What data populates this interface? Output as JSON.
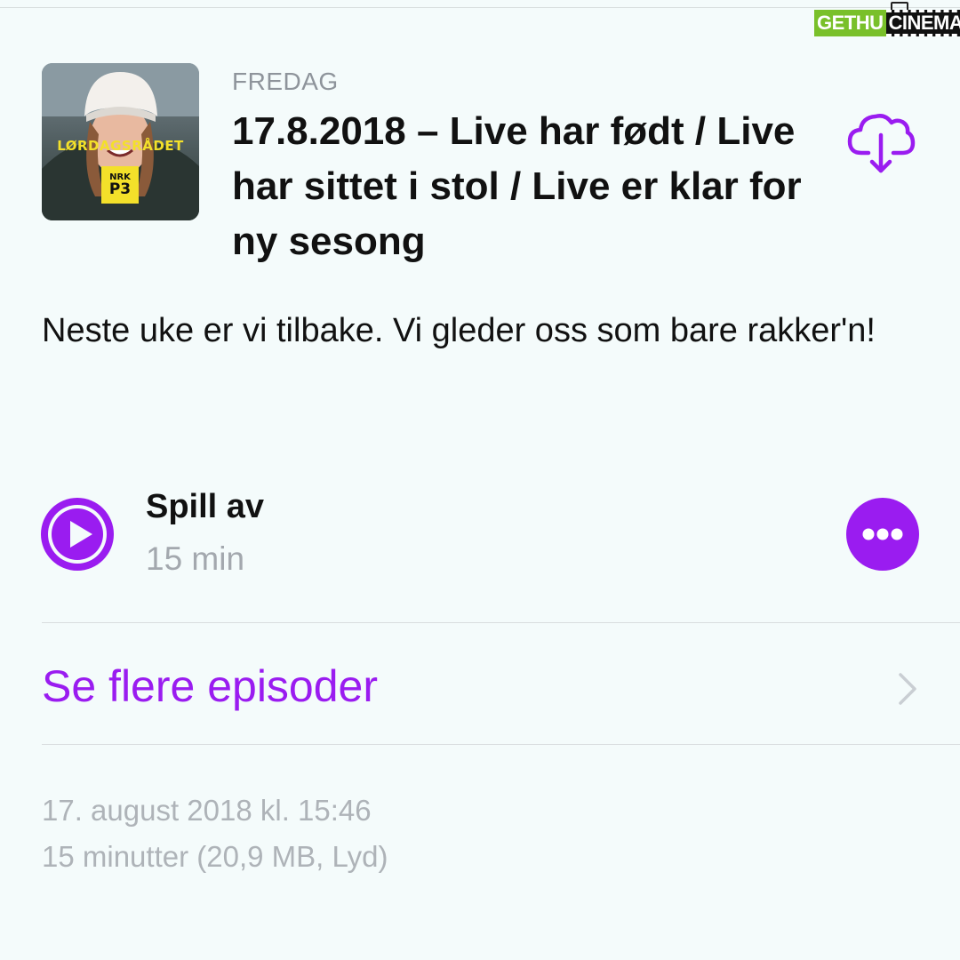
{
  "watermark": {
    "left_text": "GETHU",
    "right_text": "CINEMA"
  },
  "episode": {
    "artwork": {
      "show_name": "LØRDAGSRÅDET",
      "badge_line1": "NRK",
      "badge_line2": "P3"
    },
    "day": "FREDAG",
    "title": "17.8.2018 – Live har født / Live har sittet i stol / Live er klar for ny sesong",
    "description": "Neste uke er vi tilbake. Vi gleder oss som bare rakker'n!"
  },
  "player": {
    "play_label": "Spill av",
    "duration": "15 min"
  },
  "more_episodes": {
    "label": "Se flere episoder"
  },
  "meta": {
    "published": "17. august 2018 kl. 15:46",
    "details": "15 minutter (20,9 MB, Lyd)"
  },
  "colors": {
    "accent": "#9a1cf0",
    "background": "#f4fbfb",
    "secondary_text": "#aeb3b8"
  },
  "icons": {
    "download": "cloud-download-icon",
    "play": "play-icon",
    "more": "more-icon",
    "chevron": "chevron-right-icon"
  }
}
